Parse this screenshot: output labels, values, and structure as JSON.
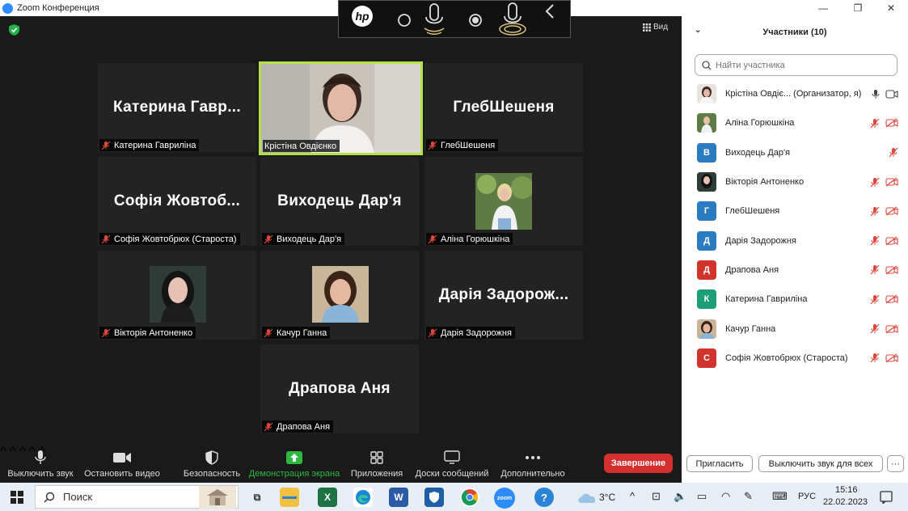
{
  "window": {
    "title": "Zoom Конференция"
  },
  "meeting": {
    "view_label": "Вид",
    "tiles": [
      {
        "big": "Катерина  Гавр...",
        "label": "Катерина Гавриліна",
        "muted": true
      },
      {
        "big": "",
        "label": "Крістіна Овдієнко",
        "muted": false,
        "video": true
      },
      {
        "big": "ГлебШешеня",
        "label": "ГлебШешеня",
        "muted": true
      },
      {
        "big": "Софія  Жовтоб...",
        "label": "Софія Жовтобрюх (Староста)",
        "muted": true
      },
      {
        "big": "Виходець Дар'я",
        "label": "Виходець Дар'я",
        "muted": true
      },
      {
        "big": "",
        "label": "Аліна Горюшкіна",
        "muted": true,
        "photo": true
      },
      {
        "big": "",
        "label": "Вікторія Антоненко",
        "muted": true,
        "photo": true
      },
      {
        "big": "",
        "label": "Качур Ганна",
        "muted": true,
        "photo": true
      },
      {
        "big": "Дарія  Задорож...",
        "label": "Дарія Задорожня",
        "muted": true
      },
      {
        "big": "Драпова Аня",
        "label": "Драпова Аня",
        "muted": true
      }
    ]
  },
  "toolbar": {
    "mute": "Выключить звук",
    "video": "Остановить видео",
    "security": "Безопасность",
    "share": "Демонстрация экрана",
    "apps": "Приложения",
    "whiteboards": "Доски сообщений",
    "more": "Дополнительно",
    "end": "Завершение"
  },
  "panel": {
    "title": "Участники (10)",
    "search_placeholder": "Найти участника",
    "participants": [
      {
        "name": "Крістіна Овдіє... (Организатор, я)",
        "avatar": "photo",
        "color": "#c9b2a6"
      },
      {
        "name": "Аліна Горюшкіна",
        "avatar": "photo",
        "color": "#6f8f5a"
      },
      {
        "name": "Виходець Дар'я",
        "avatar": "В",
        "color": "#2a7bbf"
      },
      {
        "name": "Вікторія Антоненко",
        "avatar": "photo",
        "color": "#3f4a44"
      },
      {
        "name": "ГлебШешеня",
        "avatar": "Г",
        "color": "#2a7bbf"
      },
      {
        "name": "Дарія Задорожня",
        "avatar": "Д",
        "color": "#2a7bbf"
      },
      {
        "name": "Драпова Аня",
        "avatar": "Д",
        "color": "#d0342c"
      },
      {
        "name": "Катерина Гавриліна",
        "avatar": "К",
        "color": "#1e9e78"
      },
      {
        "name": "Качур Ганна",
        "avatar": "photo",
        "color": "#a88a6c"
      },
      {
        "name": "Софія Жовтобрюх (Староста)",
        "avatar": "С",
        "color": "#d0342c"
      }
    ],
    "invite": "Пригласить",
    "mute_all": "Выключить звук для всех",
    "more": "···"
  },
  "taskbar": {
    "search": "Поиск",
    "weather": "3°C",
    "lang": "РУС",
    "time": "15:16",
    "date": "22.02.2023"
  },
  "colors": {
    "active_border": "#b6e04b",
    "muted_mic": "#e0463e",
    "end": "#d3302f",
    "share": "#2eb841"
  }
}
